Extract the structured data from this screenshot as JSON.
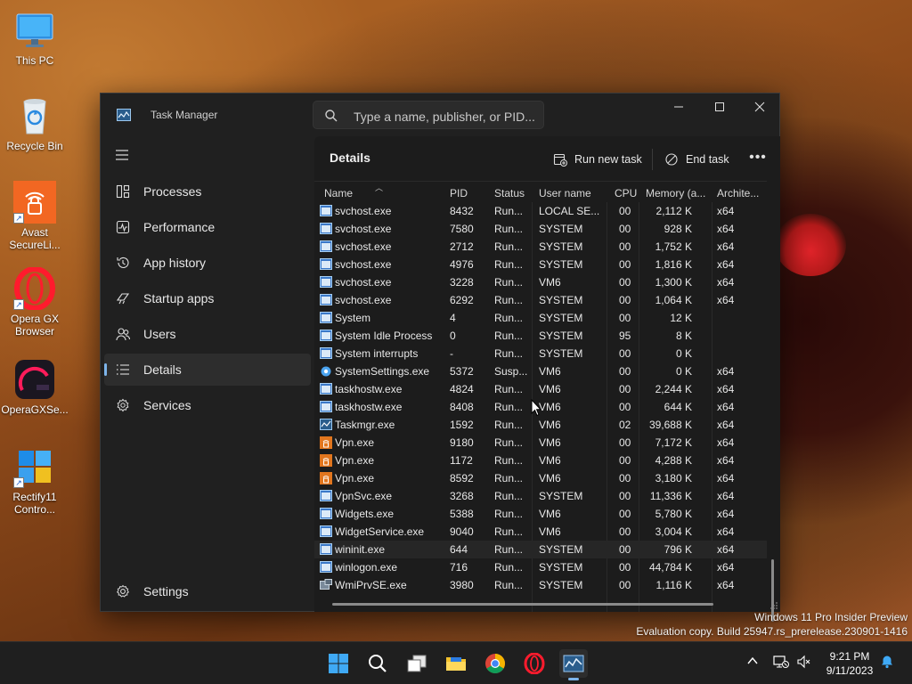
{
  "desktop": {
    "icons": [
      {
        "label": "This PC"
      },
      {
        "label": "Recycle Bin"
      },
      {
        "label": "Avast SecureLi..."
      },
      {
        "label": "Opera GX Browser"
      },
      {
        "label": "OperaGXSe..."
      },
      {
        "label": "Rectify11 Contro..."
      }
    ]
  },
  "window": {
    "title": "Task Manager",
    "search_placeholder": "Type a name, publisher, or PID...",
    "controls": {
      "minimize": "—",
      "maximize": "☐",
      "close": "✕"
    }
  },
  "sidebar": {
    "items": [
      {
        "label": "Processes",
        "icon": "processes-icon"
      },
      {
        "label": "Performance",
        "icon": "performance-icon"
      },
      {
        "label": "App history",
        "icon": "app-history-icon"
      },
      {
        "label": "Startup apps",
        "icon": "startup-apps-icon"
      },
      {
        "label": "Users",
        "icon": "users-icon"
      },
      {
        "label": "Details",
        "icon": "details-icon",
        "active": true
      },
      {
        "label": "Services",
        "icon": "services-icon"
      }
    ],
    "settings_label": "Settings"
  },
  "details": {
    "title": "Details",
    "run_new_task": "Run new task",
    "end_task": "End task",
    "more": "•••",
    "columns": {
      "name": "Name",
      "pid": "PID",
      "status": "Status",
      "user": "User name",
      "cpu": "CPU",
      "memory": "Memory (a...",
      "arch": "Archite..."
    },
    "rows": [
      {
        "name": "svchost.exe",
        "pid": "8432",
        "status": "Run...",
        "user": "LOCAL SE...",
        "cpu": "00",
        "mem": "2,112 K",
        "arch": "x64",
        "icon": "exe"
      },
      {
        "name": "svchost.exe",
        "pid": "7580",
        "status": "Run...",
        "user": "SYSTEM",
        "cpu": "00",
        "mem": "928 K",
        "arch": "x64",
        "icon": "exe"
      },
      {
        "name": "svchost.exe",
        "pid": "2712",
        "status": "Run...",
        "user": "SYSTEM",
        "cpu": "00",
        "mem": "1,752 K",
        "arch": "x64",
        "icon": "exe"
      },
      {
        "name": "svchost.exe",
        "pid": "4976",
        "status": "Run...",
        "user": "SYSTEM",
        "cpu": "00",
        "mem": "1,816 K",
        "arch": "x64",
        "icon": "exe"
      },
      {
        "name": "svchost.exe",
        "pid": "3228",
        "status": "Run...",
        "user": "VM6",
        "cpu": "00",
        "mem": "1,300 K",
        "arch": "x64",
        "icon": "exe"
      },
      {
        "name": "svchost.exe",
        "pid": "6292",
        "status": "Run...",
        "user": "SYSTEM",
        "cpu": "00",
        "mem": "1,064 K",
        "arch": "x64",
        "icon": "exe"
      },
      {
        "name": "System",
        "pid": "4",
        "status": "Run...",
        "user": "SYSTEM",
        "cpu": "00",
        "mem": "12 K",
        "arch": "",
        "icon": "exe"
      },
      {
        "name": "System Idle Process",
        "pid": "0",
        "status": "Run...",
        "user": "SYSTEM",
        "cpu": "95",
        "mem": "8 K",
        "arch": "",
        "icon": "exe"
      },
      {
        "name": "System interrupts",
        "pid": "-",
        "status": "Run...",
        "user": "SYSTEM",
        "cpu": "00",
        "mem": "0 K",
        "arch": "",
        "icon": "exe"
      },
      {
        "name": "SystemSettings.exe",
        "pid": "5372",
        "status": "Susp...",
        "user": "VM6",
        "cpu": "00",
        "mem": "0 K",
        "arch": "x64",
        "icon": "gear"
      },
      {
        "name": "taskhostw.exe",
        "pid": "4824",
        "status": "Run...",
        "user": "VM6",
        "cpu": "00",
        "mem": "2,244 K",
        "arch": "x64",
        "icon": "exe"
      },
      {
        "name": "taskhostw.exe",
        "pid": "8408",
        "status": "Run...",
        "user": "VM6",
        "cpu": "00",
        "mem": "644 K",
        "arch": "x64",
        "icon": "exe"
      },
      {
        "name": "Taskmgr.exe",
        "pid": "1592",
        "status": "Run...",
        "user": "VM6",
        "cpu": "02",
        "mem": "39,688 K",
        "arch": "x64",
        "icon": "taskmgr"
      },
      {
        "name": "Vpn.exe",
        "pid": "9180",
        "status": "Run...",
        "user": "VM6",
        "cpu": "00",
        "mem": "7,172 K",
        "arch": "x64",
        "icon": "vpn"
      },
      {
        "name": "Vpn.exe",
        "pid": "1172",
        "status": "Run...",
        "user": "VM6",
        "cpu": "00",
        "mem": "4,288 K",
        "arch": "x64",
        "icon": "vpn"
      },
      {
        "name": "Vpn.exe",
        "pid": "8592",
        "status": "Run...",
        "user": "VM6",
        "cpu": "00",
        "mem": "3,180 K",
        "arch": "x64",
        "icon": "vpn"
      },
      {
        "name": "VpnSvc.exe",
        "pid": "3268",
        "status": "Run...",
        "user": "SYSTEM",
        "cpu": "00",
        "mem": "11,336 K",
        "arch": "x64",
        "icon": "exe"
      },
      {
        "name": "Widgets.exe",
        "pid": "5388",
        "status": "Run...",
        "user": "VM6",
        "cpu": "00",
        "mem": "5,780 K",
        "arch": "x64",
        "icon": "exe"
      },
      {
        "name": "WidgetService.exe",
        "pid": "9040",
        "status": "Run...",
        "user": "VM6",
        "cpu": "00",
        "mem": "3,004 K",
        "arch": "x64",
        "icon": "exe"
      },
      {
        "name": "wininit.exe",
        "pid": "644",
        "status": "Run...",
        "user": "SYSTEM",
        "cpu": "00",
        "mem": "796 K",
        "arch": "x64",
        "icon": "exe",
        "highlight": true
      },
      {
        "name": "winlogon.exe",
        "pid": "716",
        "status": "Run...",
        "user": "SYSTEM",
        "cpu": "00",
        "mem": "44,784 K",
        "arch": "x64",
        "icon": "exe"
      },
      {
        "name": "WmiPrvSE.exe",
        "pid": "3980",
        "status": "Run...",
        "user": "SYSTEM",
        "cpu": "00",
        "mem": "1,116 K",
        "arch": "x64",
        "icon": "wmi"
      }
    ]
  },
  "watermark": {
    "line1": "Windows 11 Pro Insider Preview",
    "line2": "Evaluation copy. Build 25947.rs_prerelease.230901-1416"
  },
  "taskbar": {
    "apps": [
      "start-icon",
      "search-icon",
      "task-view-icon",
      "file-explorer-icon",
      "chrome-icon",
      "opera-icon",
      "task-manager-icon"
    ],
    "clock_time": "9:21 PM",
    "clock_date": "9/11/2023"
  },
  "colors": {
    "accent": "#7db4ea",
    "window_bg": "#202020",
    "content_bg": "#1c1c1c",
    "taskbar_bg": "#1f1f1f",
    "vpn_orange": "#e2761e"
  }
}
